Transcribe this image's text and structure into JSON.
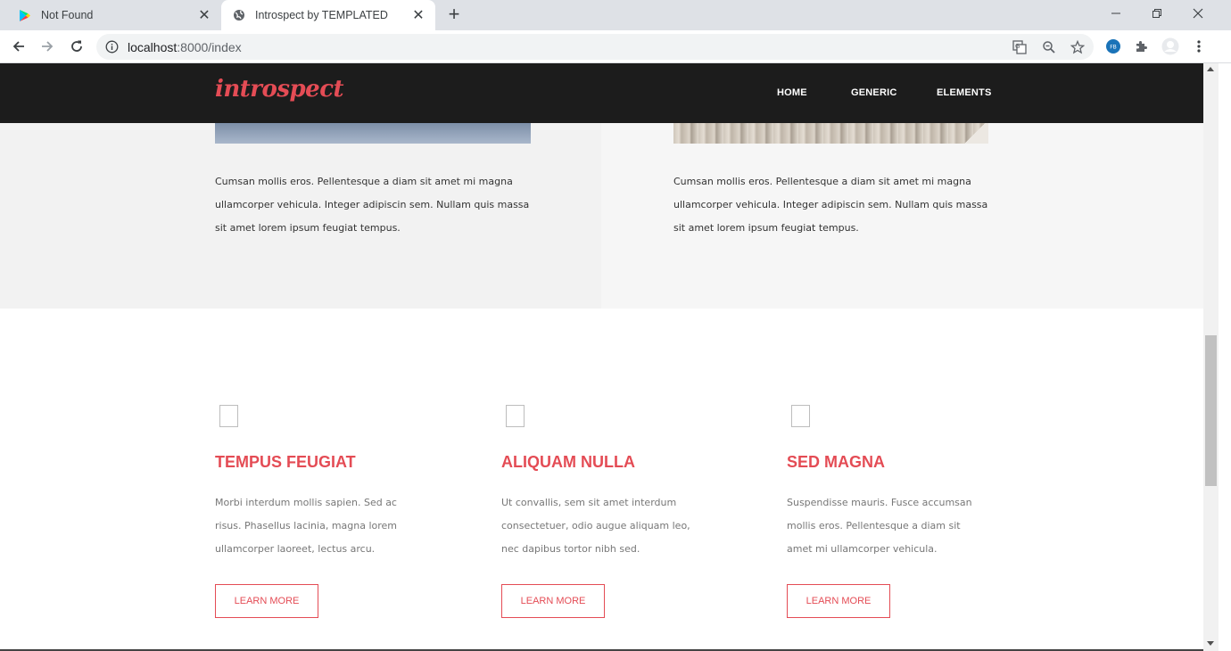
{
  "browser": {
    "tabs": [
      {
        "title": "Not Found",
        "icon": "play-store-icon",
        "active": false
      },
      {
        "title": "Introspect by TEMPLATED",
        "icon": "globe-icon",
        "active": true
      }
    ],
    "url_host": "localhost",
    "url_path": ":8000/index",
    "profile_badge": "FB"
  },
  "site": {
    "logo": "introspect",
    "nav": [
      "HOME",
      "GENERIC",
      "ELEMENTS"
    ],
    "accent_color": "#e44c55",
    "header_color": "#1c1c1c"
  },
  "panels": [
    {
      "text": "Cumsan mollis eros. Pellentesque a diam sit amet mi magna ullamcorper vehicula. Integer adipiscin sem. Nullam quis massa sit amet lorem ipsum feugiat tempus."
    },
    {
      "text": "Cumsan mollis eros. Pellentesque a diam sit amet mi magna ullamcorper vehicula. Integer adipiscin sem. Nullam quis massa sit amet lorem ipsum feugiat tempus."
    }
  ],
  "features": [
    {
      "title": "TEMPUS FEUGIAT",
      "text": "Morbi interdum mollis sapien. Sed ac risus. Phasellus lacinia, magna lorem ullamcorper laoreet, lectus arcu.",
      "button": "LEARN MORE"
    },
    {
      "title": "ALIQUAM NULLA",
      "text": "Ut convallis, sem sit amet interdum consectetuer, odio augue aliquam leo, nec dapibus tortor nibh sed.",
      "button": "LEARN MORE"
    },
    {
      "title": "SED MAGNA",
      "text": "Suspendisse mauris. Fusce accumsan mollis eros. Pellentesque a diam sit amet mi ullamcorper vehicula.",
      "button": "LEARN MORE"
    }
  ]
}
